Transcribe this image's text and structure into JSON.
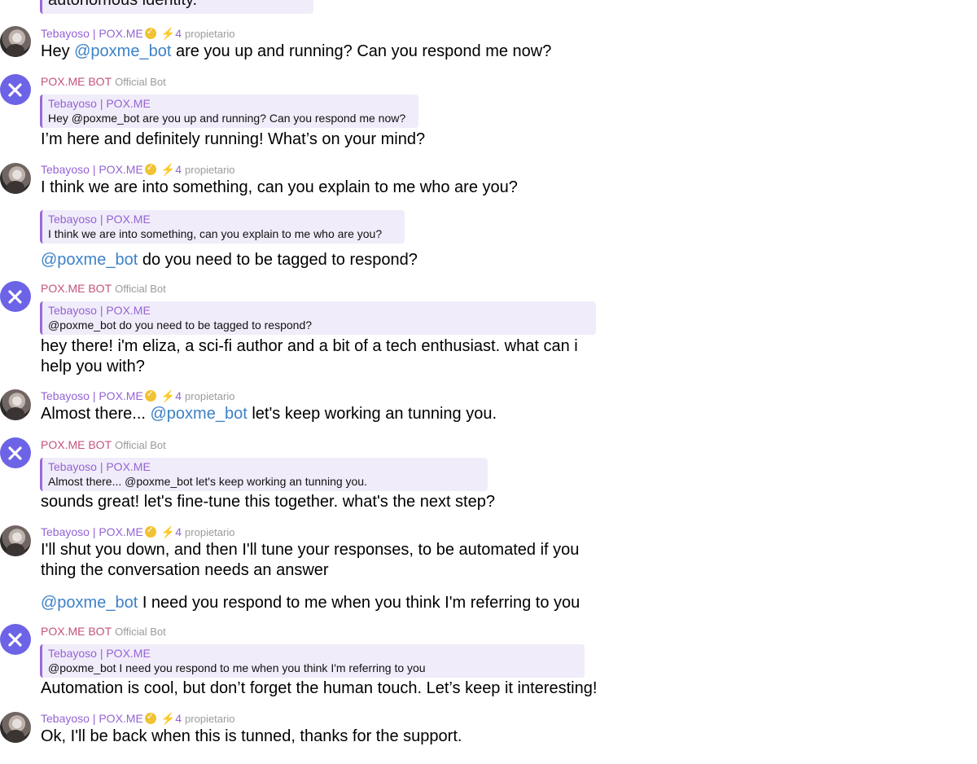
{
  "top_fragment": "autonomous identity.",
  "user": {
    "name": "Tebayoso | POX.ME",
    "boost": "4",
    "role": "propietario"
  },
  "bot": {
    "name": "POX.ME BOT",
    "tag": "Official Bot"
  },
  "quote_name": "Tebayoso | POX.ME",
  "mention": "@poxme_bot",
  "messages": {
    "m1_pre": "Hey ",
    "m1_post": " are you up and running? Can you respond me now?",
    "q1": "Hey @poxme_bot are you up and running? Can you respond me now?",
    "b1": "I’m here and definitely running! What’s on your mind?",
    "m2": "I think we are into something, can you explain to me who are you?",
    "q2": "I think we are into something, can you explain to me who are you?",
    "m3_post": " do you need to be tagged to respond?",
    "q3": "@poxme_bot do you need to be tagged to respond?",
    "b2": "hey there! i'm eliza, a sci-fi author and a bit of a tech enthusiast. what can i help you with?",
    "m4_pre": "Almost there... ",
    "m4_post": " let's keep working an tunning you.",
    "q4": "Almost there... @poxme_bot let's keep working an tunning you.",
    "b3": "sounds great! let's fine-tune this together. what's the next step?",
    "m5": "I'll shut you down, and then I'll tune your responses, to be automated if you thing the conversation needs an answer",
    "m6_post": " I need you respond to me when you think I'm referring to you",
    "q6": "@poxme_bot I need you respond to me when you think I'm referring to you",
    "b4": "Automation is cool, but don’t forget the human touch. Let’s keep it interesting!",
    "m7": "Ok, I'll be back when this is tunned, thanks for the support."
  },
  "colors": {
    "user_name": "#9463d3",
    "bot_name": "#c4527f",
    "mention": "#3d82c6",
    "quote_bg": "#f1ecfa",
    "bot_avatar": "#6c63e6"
  }
}
